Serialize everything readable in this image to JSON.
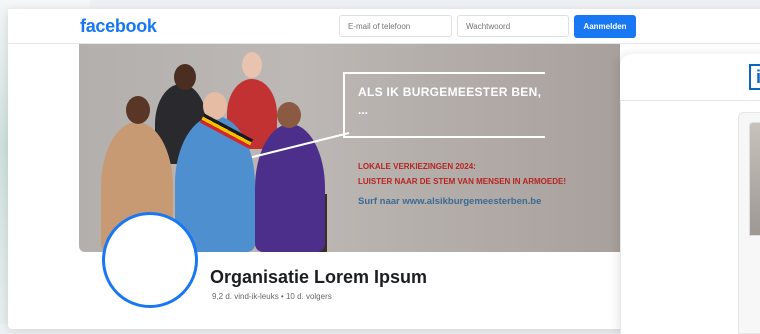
{
  "header": {
    "logo": "facebook",
    "email_placeholder": "E-mail of telefoon",
    "password_placeholder": "Wachtwoord",
    "login_label": "Aanmelden"
  },
  "cover": {
    "headline": "ALS IK BURGEMEESTER BEN,",
    "ellipsis": "...",
    "red_line_1": "LOKALE VERKIEZINGEN 2024:",
    "red_line_2": "LUISTER NAAR DE STEM VAN MENSEN IN ARMOEDE!",
    "url_line": "Surf naar www.alsikburgemeesterben.be"
  },
  "page": {
    "name": "Organisatie Lorem Ipsum",
    "stats": "9,2 d. vind-ik-leuks • 10 d. volgers"
  },
  "overlay": {
    "icon_letter": "in",
    "icon": "linkedin-icon"
  },
  "colors": {
    "brand": "#1877f2",
    "linkedin": "#0a66c2",
    "red_text": "#b8231f",
    "url_text": "#3a6a93"
  }
}
